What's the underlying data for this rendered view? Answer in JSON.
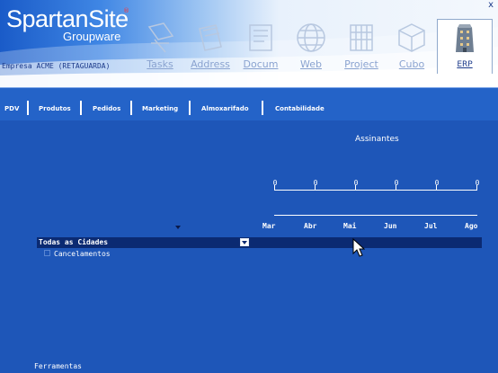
{
  "brand": {
    "name": "SpartanSite",
    "reg": "®",
    "sub": "Groupware"
  },
  "company": "Empresa ACME (RETAGUARDA)",
  "window": {
    "close": "x"
  },
  "apps": [
    {
      "label": "Tasks",
      "icon": "tasks-icon"
    },
    {
      "label": "Address",
      "icon": "address-book-icon"
    },
    {
      "label": "Docum",
      "icon": "documents-icon"
    },
    {
      "label": "Web",
      "icon": "globe-icon"
    },
    {
      "label": "Project",
      "icon": "project-icon"
    },
    {
      "label": "Cubo",
      "icon": "cube-icon"
    },
    {
      "label": "ERP",
      "icon": "building-icon",
      "active": true
    }
  ],
  "nav": [
    "PDV",
    "Produtos",
    "Pedidos",
    "Marketing",
    "Almoxarifado",
    "Contabilidade"
  ],
  "chart": {
    "title": "Assinantes",
    "tick_values": [
      "0",
      "0",
      "0",
      "0",
      "0",
      "0"
    ],
    "months": [
      "Mar",
      "Abr",
      "Mai",
      "Jun",
      "Jul",
      "Ago"
    ]
  },
  "chart_data": {
    "type": "bar",
    "title": "Assinantes",
    "categories": [
      "Mar",
      "Abr",
      "Mai",
      "Jun",
      "Jul",
      "Ago"
    ],
    "values": [
      0,
      0,
      0,
      0,
      0,
      0
    ]
  },
  "filter": {
    "city": "Todas as Cidades",
    "cancel_label": "Cancelamentos"
  },
  "footer": {
    "tools": "Ferramentas"
  },
  "colors": {
    "background": "#1e56b8",
    "navbar": "#2463c8",
    "selected_row": "#0b2a72"
  }
}
